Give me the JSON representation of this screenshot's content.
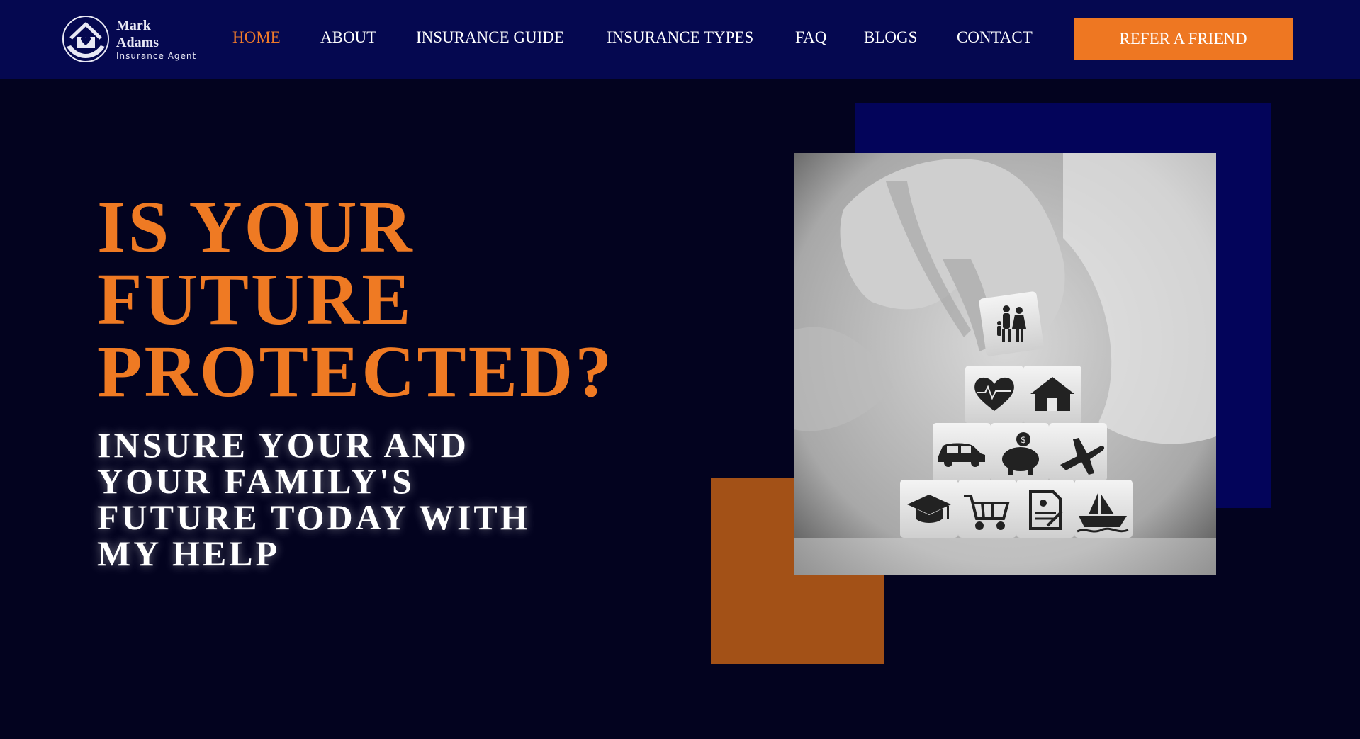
{
  "brand": {
    "name": "Mark Adams",
    "subtitle": "Insurance Agent",
    "logo_icon": "house-heart-hands-icon"
  },
  "nav": {
    "items": [
      {
        "label": "HOME",
        "active": true
      },
      {
        "label": "ABOUT",
        "active": false
      },
      {
        "label": "INSURANCE GUIDE",
        "active": false
      },
      {
        "label": "INSURANCE TYPES",
        "active": false
      },
      {
        "label": "FAQ",
        "active": false
      },
      {
        "label": "BLOGS",
        "active": false
      },
      {
        "label": "CONTACT",
        "active": false
      }
    ],
    "cta_label": "REFER A FRIEND"
  },
  "hero": {
    "headline_lines": [
      "IS YOUR",
      "FUTURE",
      "PROTECTED?"
    ],
    "subhead_lines": [
      "INSURE YOUR AND",
      "YOUR FAMILY'S",
      "FUTURE TODAY WITH",
      "MY HELP"
    ],
    "image_icons": [
      "family-icon",
      "heart-icon",
      "house-icon",
      "car-icon",
      "piggy-bank-icon",
      "airplane-icon",
      "graduation-cap-icon",
      "shopping-cart-icon",
      "document-icon",
      "ship-icon"
    ]
  },
  "colors": {
    "nav_bg": "#050850",
    "page_bg": "#03031f",
    "accent_orange": "#ee7722",
    "deco_blue": "#03045a",
    "deco_orange": "#a35117"
  }
}
